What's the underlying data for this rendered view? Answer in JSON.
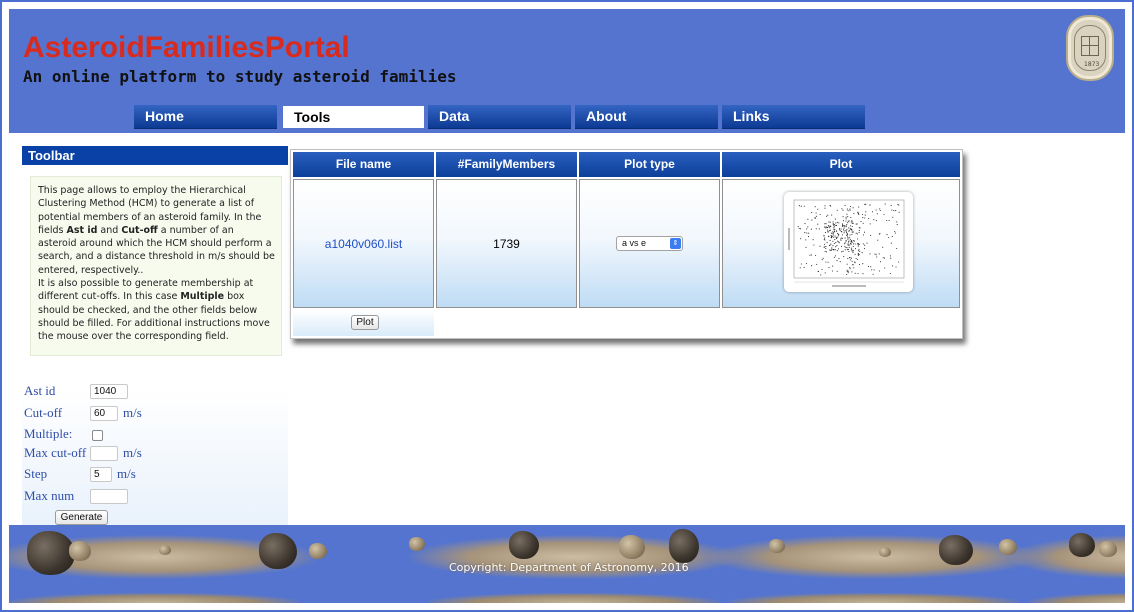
{
  "header": {
    "title": "AsteroidFamiliesPortal",
    "subtitle": "An online platform to study asteroid families",
    "seal_year": "1873"
  },
  "nav": {
    "tabs": [
      {
        "label": "Home",
        "active": false
      },
      {
        "label": "Tools",
        "active": true
      },
      {
        "label": "Data",
        "active": false
      },
      {
        "label": "About",
        "active": false
      },
      {
        "label": "Links",
        "active": false
      }
    ]
  },
  "toolbar": {
    "title": "Toolbar",
    "help": {
      "p1_a": "This page allows to employ the Hierarchical Clustering Method (HCM) to generate a list of potential members of an asteroid family. In the fields ",
      "p1_b": "Ast id",
      "p1_c": " and ",
      "p1_d": "Cut-off",
      "p1_e": " a number of an asteroid around which the HCM should perform a search, and a distance threshold in m/s should be entered, respectively..",
      "p2_a": "It is also possible to generate membership at different cut-offs. In this case ",
      "p2_b": "Multiple",
      "p2_c": " box should be checked, and the other fields below should be filled. For additional instructions move the mouse over the corresponding field."
    },
    "form": {
      "ast_id_label": "Ast id",
      "ast_id_value": "1040",
      "cutoff_label": "Cut-off",
      "cutoff_value": "60",
      "cutoff_unit": "m/s",
      "multiple_label": "Multiple:",
      "multiple_checked": false,
      "max_cutoff_label": "Max cut-off",
      "max_cutoff_value": "",
      "max_cutoff_unit": "m/s",
      "step_label": "Step",
      "step_value": "5",
      "step_unit": "m/s",
      "max_num_label": "Max num",
      "max_num_value": "",
      "generate_label": "Generate"
    }
  },
  "results": {
    "headers": [
      "File name",
      "#FamilyMembers",
      "Plot type",
      "Plot"
    ],
    "row": {
      "file_name": "a1040v060.list",
      "family_members": "1739",
      "plot_type": "a vs e"
    },
    "plot_button": "Plot"
  },
  "footer": {
    "copyright": "Copyright: Department of Astronomy, 2016"
  },
  "colors": {
    "header_bg": "#5474cf",
    "title_red": "#d92a1e",
    "nav_blue": "#0c3a93",
    "link_blue": "#1f4fc4"
  }
}
